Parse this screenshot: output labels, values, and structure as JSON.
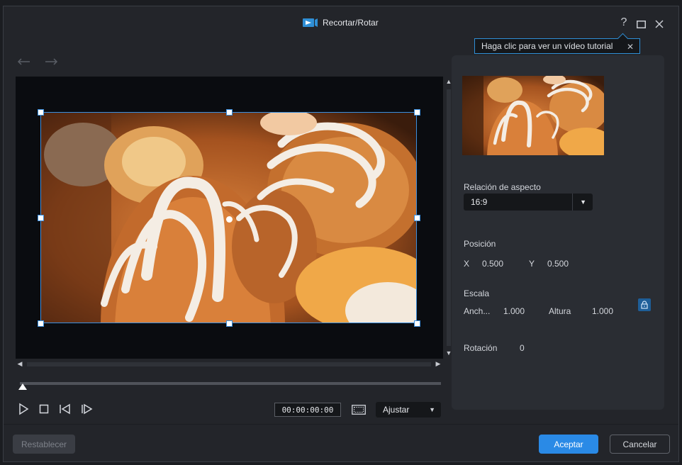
{
  "window": {
    "title": "Recortar/Rotar",
    "accent_color": "#2a8ae6"
  },
  "tooltip": {
    "text": "Haga clic para ver un vídeo tutorial"
  },
  "player": {
    "timecode": "00:00:00:00",
    "fit_option": "Ajustar"
  },
  "panel": {
    "aspect_label": "Relación de aspecto",
    "aspect_value": "16:9",
    "position_label": "Posición",
    "x_label": "X",
    "x_value": "0.500",
    "y_label": "Y",
    "y_value": "0.500",
    "scale_label": "Escala",
    "width_label": "Anch...",
    "width_value": "1.000",
    "height_label": "Altura",
    "height_value": "1.000",
    "rotation_label": "Rotación",
    "rotation_value": "0"
  },
  "footer": {
    "reset_label": "Restablecer",
    "accept_label": "Aceptar",
    "cancel_label": "Cancelar"
  },
  "icons": [
    "app-logo-icon",
    "help-icon",
    "maximize-icon",
    "close-icon",
    "undo-icon",
    "redo-icon",
    "play-icon",
    "stop-icon",
    "previous-frame-icon",
    "next-frame-icon",
    "safe-zone-icon",
    "lock-icon"
  ]
}
